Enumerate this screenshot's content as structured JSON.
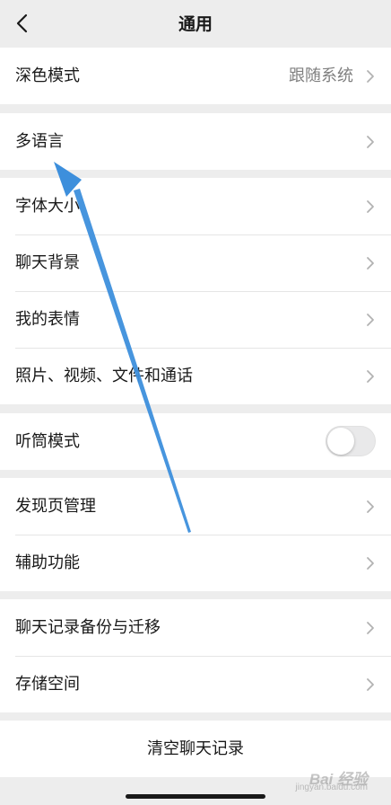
{
  "header": {
    "title": "通用"
  },
  "groups": [
    {
      "rows": [
        {
          "label": "深色模式",
          "value": "跟随系统"
        }
      ]
    },
    {
      "rows": [
        {
          "label": "多语言"
        }
      ]
    },
    {
      "rows": [
        {
          "label": "字体大小"
        },
        {
          "label": "聊天背景"
        },
        {
          "label": "我的表情"
        },
        {
          "label": "照片、视频、文件和通话"
        }
      ]
    },
    {
      "rows": [
        {
          "label": "听筒模式",
          "toggle": false
        }
      ]
    },
    {
      "rows": [
        {
          "label": "发现页管理"
        },
        {
          "label": "辅助功能"
        }
      ]
    },
    {
      "rows": [
        {
          "label": "聊天记录备份与迁移"
        },
        {
          "label": "存储空间"
        }
      ]
    },
    {
      "rows": [
        {
          "label": "清空聊天记录"
        }
      ]
    }
  ],
  "watermark": {
    "text": "Bai 经验",
    "sub": "jingyan.baidu.com"
  },
  "colors": {
    "background": "#ededed",
    "row": "#ffffff",
    "text": "#191919",
    "secondary": "#7f7f7f",
    "arrow": "#3d8fdc"
  }
}
